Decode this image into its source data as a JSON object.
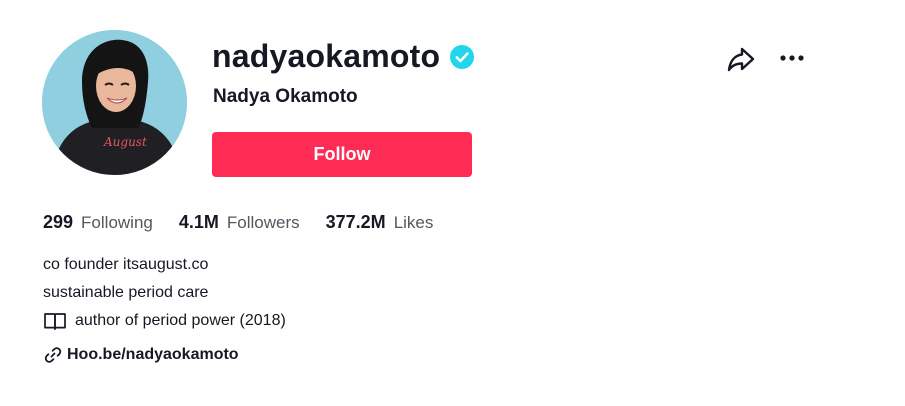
{
  "profile": {
    "username": "nadyaokamoto",
    "display_name": "Nadya Okamoto",
    "verified": true,
    "follow_label": "Follow"
  },
  "stats": [
    {
      "value": "299",
      "label": "Following"
    },
    {
      "value": "4.1M",
      "label": "Followers"
    },
    {
      "value": "377.2M",
      "label": "Likes"
    }
  ],
  "bio": {
    "line1": "co founder itsaugust.co",
    "line2": "sustainable period care",
    "line3": "author of period power (2018)",
    "line3_icon": "open-book-icon"
  },
  "link": {
    "text": "Hoo.be/nadyaokamoto",
    "icon": "link-icon"
  },
  "actions": {
    "share_icon": "share-icon",
    "more_icon": "more-options-icon"
  },
  "colors": {
    "follow_bg": "#fe2c55",
    "verified": "#20d5ec",
    "text": "#161823",
    "secondary_text": "#555760"
  }
}
